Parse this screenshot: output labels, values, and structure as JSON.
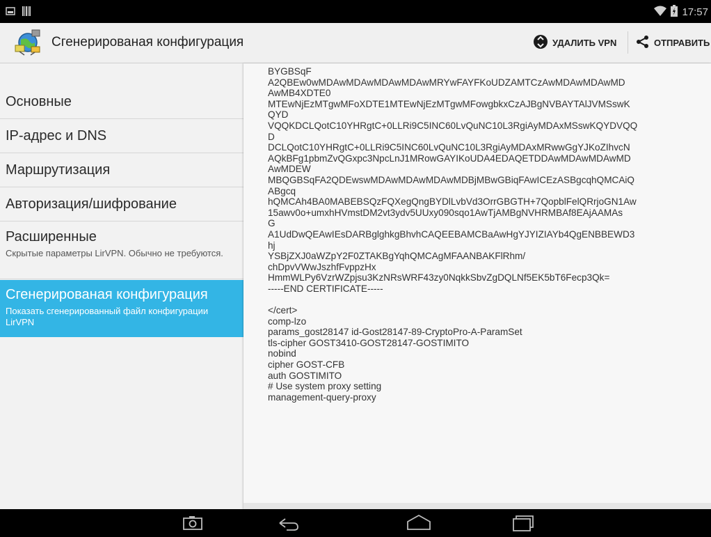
{
  "status_bar": {
    "time": "17:57",
    "icons": [
      "picture-icon",
      "barcode-icon",
      "wifi-icon",
      "battery-icon"
    ]
  },
  "action_bar": {
    "title": "Сгенерированая конфигурация",
    "delete_label": "УДАЛИТЬ VPN",
    "send_label": "ОТПРАВИТЬ",
    "icons": [
      "app-network-icon",
      "recycle-icon",
      "share-icon"
    ]
  },
  "sidebar": {
    "items": [
      {
        "label": "Основные"
      },
      {
        "label": "IP-адрес и DNS"
      },
      {
        "label": "Маршрутизация"
      },
      {
        "label": "Авторизация/шифрование"
      },
      {
        "label": "Расширенные",
        "sub": "Скрытые параметры LirVPN. Обычно не требуются."
      },
      {
        "label": "Сгенерированая конфигурация",
        "sub": "Показать сгенерированный файл конфигурации LirVPN",
        "selected": true
      }
    ]
  },
  "config": {
    "text": "BYGBSqF\nA2QBEw0wMDAwMDAwMDAwMDAwMRYwFAYFKoUDZAMTCzAwMDAwMDAwMD\nAwMB4XDTE0\nMTEwNjEzMTgwMFoXDTE1MTEwNjEzMTgwMFowgbkxCzAJBgNVBAYTAlJVMSswK\nQYD\nVQQKDCLQotC10YHRgtC+0LLRi9C5INC60LvQuNC10L3RgiAyMDAxMSswKQYDVQQ\nD\nDCLQotC10YHRgtC+0LLRi9C5INC60LvQuNC10L3RgiAyMDAxMRwwGgYJKoZIhvcN\nAQkBFg1pbmZvQGxpc3NpcLnJ1MRowGAYIKoUDA4EDAQETDDAwMDAwMDAwMD\nAwMDEW\nMBQGBSqFA2QDEwswMDAwMDAwMDAwMDBjMBwGBiqFAwICEzASBgcqhQMCAiQ\nABgcq\nhQMCAh4BA0MABEBSQzFQXegQngBYDlLvbVd3OrrGBGTH+7QopblFelQRrjoGN1Aw\n15awv0o+umxhHVmstDM2vt3ydv5UUxy090sqo1AwTjAMBgNVHRMBAf8EAjAAMAs\nG\nA1UdDwQEAwIEsDARBglghkgBhvhCAQEEBAMCBaAwHgYJYIZIAYb4QgENBBEWD3\nhj\nYSBjZXJ0aWZpY2F0ZTAKBgYqhQMCAgMFAANBAKFlRhm/\nchDpvVWwJszhfFvppzHx\nHmmWLPy6VzrWZpjsu3KzNRsWRF43zy0NqkkSbvZgDQLNf5EK5bT6Fecp3Qk=\n-----END CERTIFICATE-----\n\n</cert>\ncomp-lzo\nparams_gost28147 id-Gost28147-89-CryptoPro-A-ParamSet\ntls-cipher GOST3410-GOST28147-GOSTIMITO\nnobind\ncipher GOST-CFB\nauth GOSTIMITO\n# Use system proxy setting\nmanagement-query-proxy"
  },
  "nav_bar": {
    "icons": [
      "screenshot-icon",
      "back-icon",
      "home-icon",
      "recents-icon"
    ]
  },
  "colors": {
    "accent": "#33b5e5",
    "statusbar": "#000000",
    "actionbar": "#f0f0f0"
  }
}
